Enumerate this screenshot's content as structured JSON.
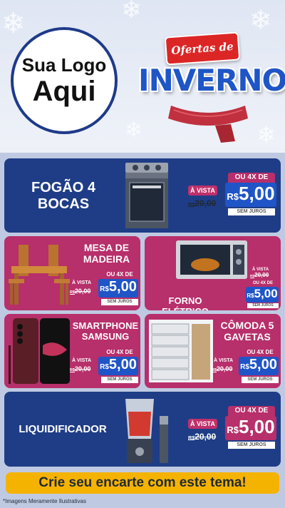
{
  "header": {
    "logo_line1": "Sua Logo",
    "logo_line2": "Aqui",
    "banner_text": "Ofertas de",
    "title_text": "INVERNO"
  },
  "products": [
    {
      "name_l1": "FOGÃO 4",
      "name_l2": "BOCAS",
      "a_vista": "À VISTA",
      "old_price": "20,00",
      "installments": "OU 4X DE",
      "price": "5,00",
      "no_interest": "SEM JUROS"
    },
    {
      "name_l1": "MESA DE",
      "name_l2": "MADEIRA",
      "a_vista": "À VISTA",
      "old_price": "20,00",
      "installments": "OU 4X DE",
      "price": "5,00",
      "no_interest": "SEM JUROS"
    },
    {
      "name_l1": "FORNO ELÉTRICO",
      "name_l2": "",
      "a_vista": "À VISTA",
      "old_price": "20,00",
      "installments": "OU 4X DE",
      "price": "5,00",
      "no_interest": "SEM JUROS"
    },
    {
      "name_l1": "SMARTPHONE",
      "name_l2": "SAMSUNG",
      "a_vista": "À VISTA",
      "old_price": "20,00",
      "installments": "OU 4X DE",
      "price": "5,00",
      "no_interest": "SEM JUROS"
    },
    {
      "name_l1": "CÔMODA 5",
      "name_l2": "GAVETAS",
      "a_vista": "À VISTA",
      "old_price": "20,00",
      "installments": "OU 4X DE",
      "price": "5,00",
      "no_interest": "SEM JUROS"
    },
    {
      "name_l1": "LIQUIDIFICADOR",
      "name_l2": "",
      "a_vista": "À VISTA",
      "old_price": "20,00",
      "installments": "OU 4X DE",
      "price": "5,00",
      "no_interest": "SEM JUROS"
    }
  ],
  "currency_small": "R$",
  "currency": "R$",
  "cta": "Crie seu encarte com este tema!",
  "disclaimer": "*Imagens Meramente Ilustrativas",
  "colors": {
    "blue": "#1f3d86",
    "pink": "#b72f6b",
    "price_blue": "#1f55c7",
    "cta": "#f5b301"
  }
}
